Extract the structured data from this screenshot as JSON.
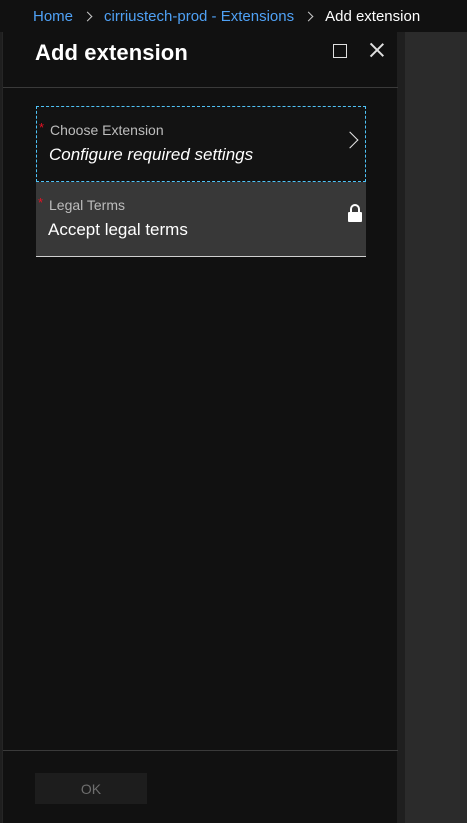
{
  "breadcrumb": {
    "items": [
      {
        "label": "Home"
      },
      {
        "label": "cirriustech-prod - Extensions"
      }
    ],
    "current": "Add extension"
  },
  "blade": {
    "title": "Add extension",
    "icons": {
      "maximize": "maximize-icon",
      "close": "close-icon"
    }
  },
  "form": {
    "extension": {
      "required": "*",
      "label": "Choose Extension",
      "value": "Configure required settings",
      "icon": "chevron-right-icon"
    },
    "legal": {
      "required": "*",
      "label": "Legal Terms",
      "value": "Accept legal terms",
      "icon": "lock-icon"
    }
  },
  "footer": {
    "ok_label": "OK"
  },
  "colors": {
    "link": "#4fa1f5",
    "required": "#e81123",
    "focus_border": "#4fc3f7",
    "blade_bg": "#111111"
  }
}
